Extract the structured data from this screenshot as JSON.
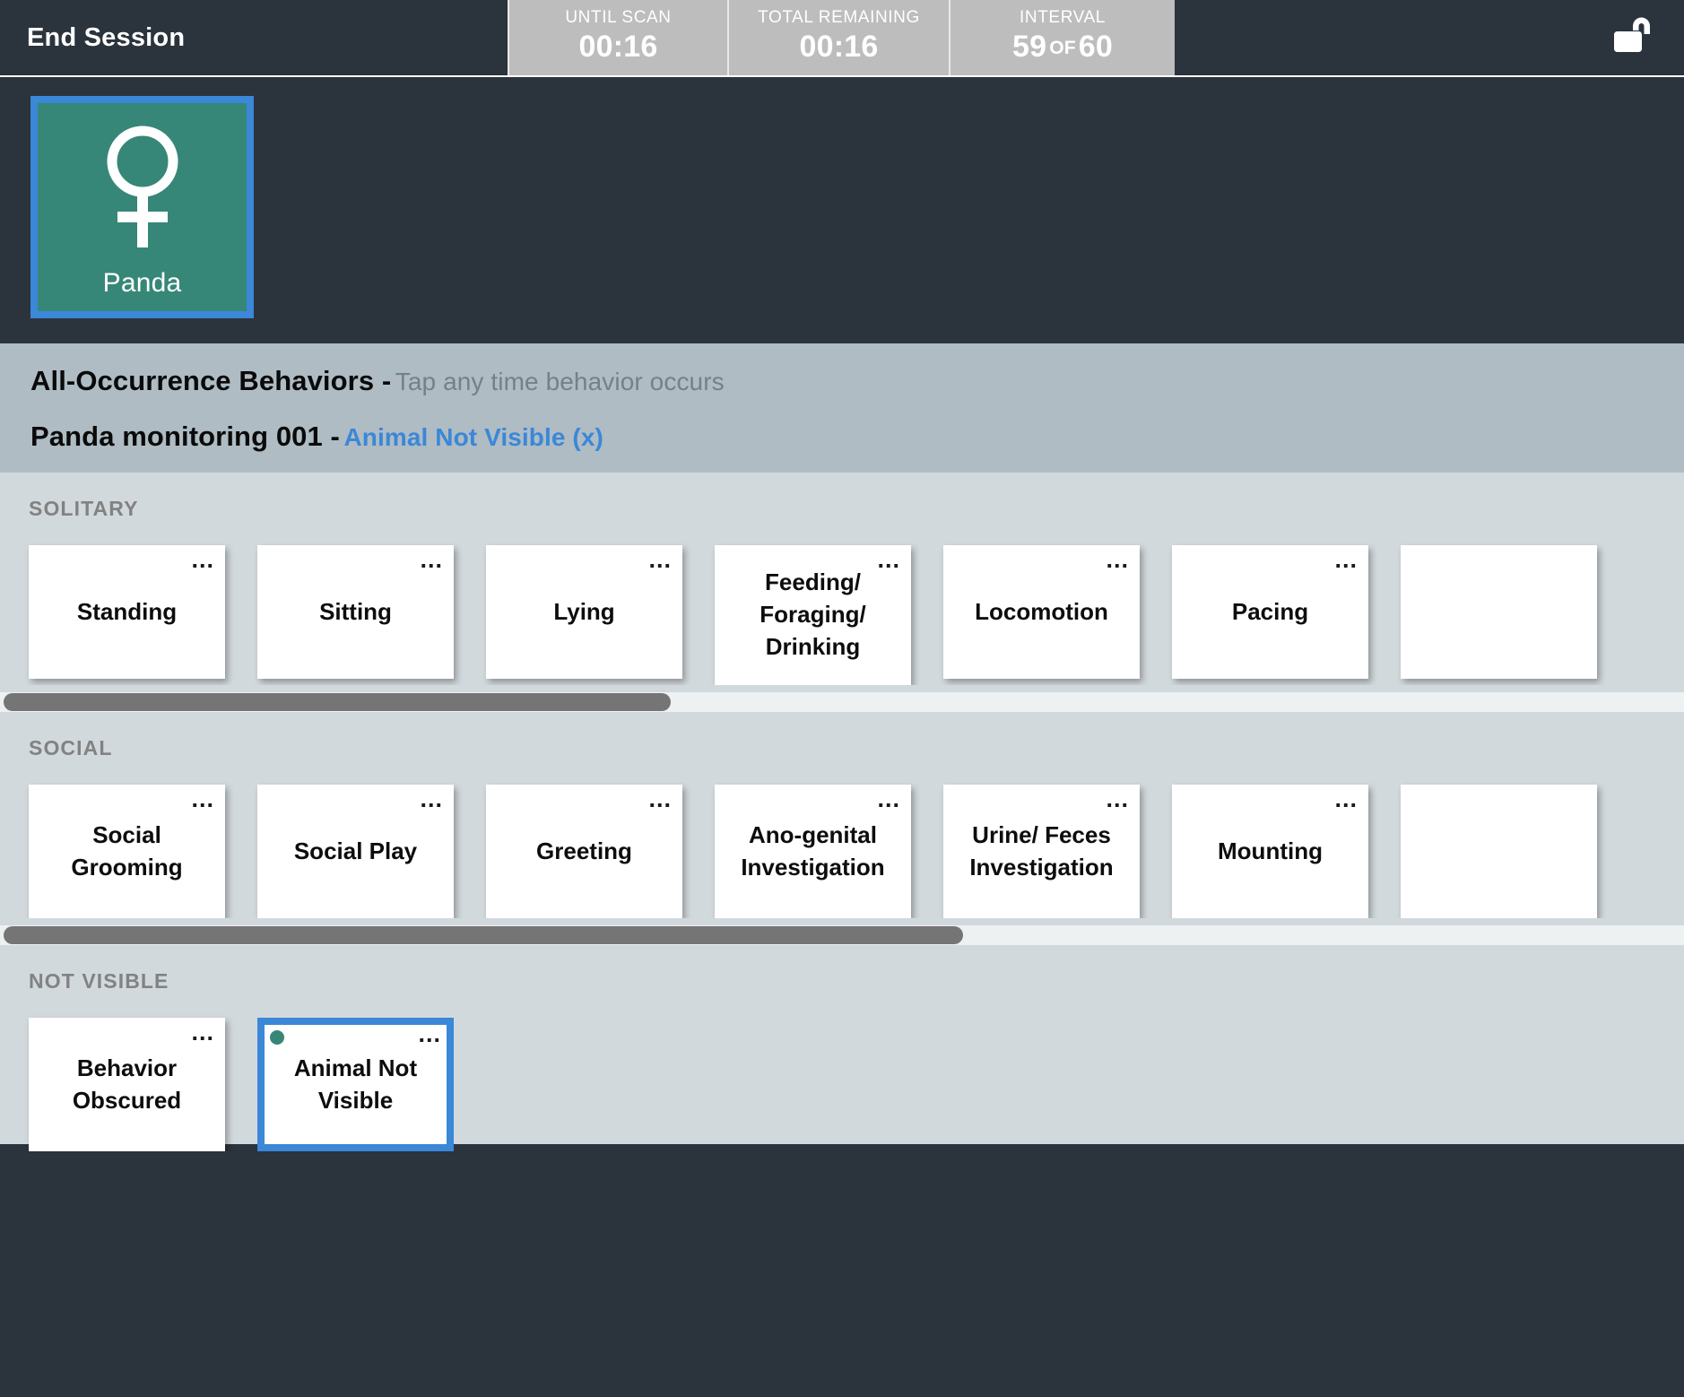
{
  "topbar": {
    "end_session_label": "End Session",
    "timers": [
      {
        "label": "UNTIL SCAN",
        "value": "00:16"
      },
      {
        "label": "TOTAL REMAINING",
        "value": "00:16"
      }
    ],
    "interval": {
      "label": "INTERVAL",
      "current": "59",
      "of": "OF",
      "total": "60"
    },
    "lock_icon": "unlock-icon"
  },
  "subject": {
    "name": "Panda",
    "sex_icon": "female-icon",
    "selected": true,
    "card_color": "#378778",
    "selection_color": "#3b87d8"
  },
  "header": {
    "title": "All-Occurrence Behaviors -",
    "subtitle": "Tap any time behavior occurs",
    "session_title": "Panda monitoring 001 -",
    "session_link": "Animal Not Visible (x)",
    "link_color": "#3b87d8"
  },
  "sections": [
    {
      "title": "SOLITARY",
      "scroll_thumb_percent": 39.6,
      "cards": [
        {
          "label": "Standing",
          "menu": "...",
          "selected": false,
          "multiline": false
        },
        {
          "label": "Sitting",
          "menu": "...",
          "selected": false,
          "multiline": false
        },
        {
          "label": "Lying",
          "menu": "...",
          "selected": false,
          "multiline": false
        },
        {
          "label": "Feeding/ Foraging/ Drinking",
          "menu": "...",
          "selected": false,
          "multiline": true
        },
        {
          "label": "Locomotion",
          "menu": "...",
          "selected": false,
          "multiline": false
        },
        {
          "label": "Pacing",
          "menu": "...",
          "selected": false,
          "multiline": false
        },
        {
          "label": "",
          "menu": "",
          "selected": false,
          "multiline": false
        }
      ]
    },
    {
      "title": "SOCIAL",
      "scroll_thumb_percent": 57.0,
      "cards": [
        {
          "label": "Social Grooming",
          "menu": "...",
          "selected": false,
          "multiline": true
        },
        {
          "label": "Social Play",
          "menu": "...",
          "selected": false,
          "multiline": false
        },
        {
          "label": "Greeting",
          "menu": "...",
          "selected": false,
          "multiline": false
        },
        {
          "label": "Ano-genital Investigation",
          "menu": "...",
          "selected": false,
          "multiline": true
        },
        {
          "label": "Urine/ Feces Investigation",
          "menu": "...",
          "selected": false,
          "multiline": true
        },
        {
          "label": "Mounting",
          "menu": "...",
          "selected": false,
          "multiline": false
        },
        {
          "label": "",
          "menu": "",
          "selected": false,
          "multiline": false
        }
      ]
    },
    {
      "title": "NOT VISIBLE",
      "scroll_thumb_percent": 0,
      "cards": [
        {
          "label": "Behavior Obscured",
          "menu": "...",
          "selected": false,
          "multiline": true
        },
        {
          "label": "Animal Not Visible",
          "menu": "...",
          "selected": true,
          "multiline": true,
          "status_dot": true
        }
      ]
    }
  ]
}
